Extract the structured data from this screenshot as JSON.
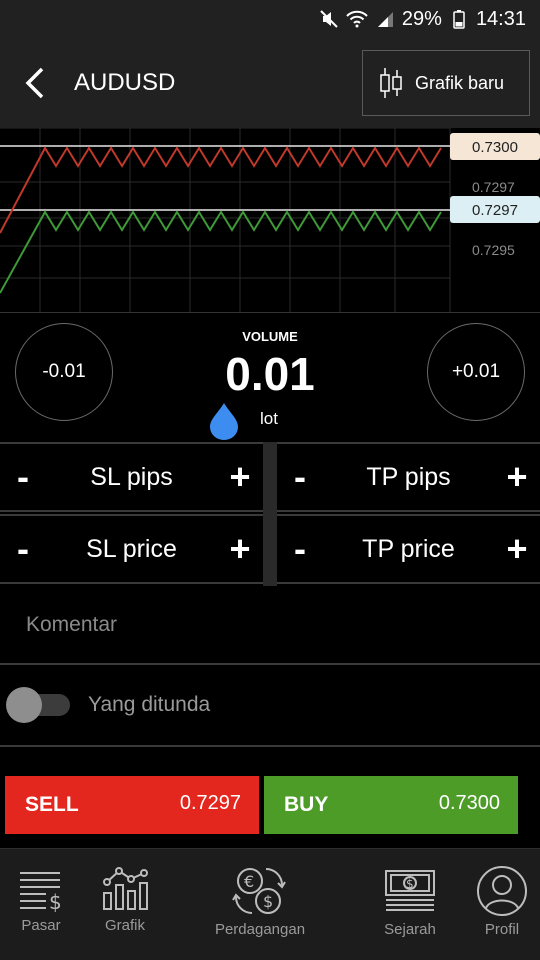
{
  "status_bar": {
    "battery": "29%",
    "time": "14:31"
  },
  "header": {
    "title": "AUDUSD",
    "new_chart_label": "Grafik baru"
  },
  "chart": {
    "price_tags": {
      "ask": "0.7300",
      "bid": "0.7297"
    },
    "axis_labels": [
      "0.7297",
      "0.7295"
    ],
    "colors": {
      "ask_line": "#c0392b",
      "bid_line": "#3e9a37",
      "ask_tag_bg": "#f6e6d6",
      "bid_tag_bg": "#dceff4"
    }
  },
  "volume": {
    "label": "VOLUME",
    "value": "0.01",
    "unit": "lot",
    "decrease_label": "-0.01",
    "increase_label": "+0.01"
  },
  "controls": {
    "minus_symbol": "-",
    "plus_symbol": "+",
    "sl_pips": "SL pips",
    "tp_pips": "TP pips",
    "sl_price": "SL price",
    "tp_price": "TP price"
  },
  "comment": {
    "placeholder": "Komentar"
  },
  "pending": {
    "label": "Yang ditunda",
    "enabled": false
  },
  "trade": {
    "sell": {
      "label": "SELL",
      "price": "0.7297",
      "color": "#e3271e"
    },
    "buy": {
      "label": "BUY",
      "price": "0.7300",
      "color": "#4d9c28"
    }
  },
  "nav": {
    "items": [
      {
        "label": "Pasar",
        "icon": "market-icon"
      },
      {
        "label": "Grafik",
        "icon": "chart-icon"
      },
      {
        "label": "Perdagangan",
        "icon": "trading-icon"
      },
      {
        "label": "Sejarah",
        "icon": "history-icon"
      },
      {
        "label": "Profil",
        "icon": "profile-icon"
      }
    ]
  }
}
